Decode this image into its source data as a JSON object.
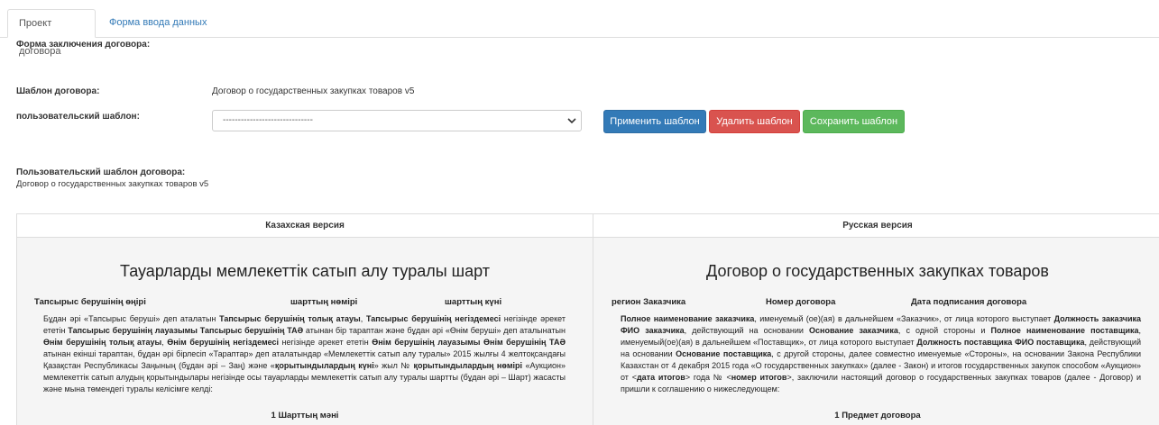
{
  "tabs": [
    {
      "label": "Проект договора",
      "active": true
    },
    {
      "label": "Форма ввода данных",
      "active": false
    }
  ],
  "form": {
    "conclusion_label": "Форма заключения договора:",
    "template_label": "Шаблон договора:",
    "template_value": "Договор о государственных закупках товаров v5",
    "user_template_label": "пользовательский шаблон:",
    "user_template_selected": "------------------------------",
    "buttons": {
      "apply": "Применить шаблон",
      "delete": "Удалить шаблон",
      "save": "Сохранить шаблон"
    },
    "user_template_caption": "Пользовательский шаблон договора:",
    "user_template_name": "Договор о государственных закупках товаров v5"
  },
  "versions": {
    "kz": {
      "header": "Казахская версия",
      "title": "Тауарларды мемлекеттік сатып алу туралы шарт",
      "meta": [
        "Тапсырыс берушінің өңірі",
        "шарттың нөмірі",
        "шарттың күні"
      ],
      "section": "1 Шарттың мәні"
    },
    "ru": {
      "header": "Русская версия",
      "title": "Договор о государственных закупках товаров",
      "meta": [
        "регион Заказчика",
        "Номер договора",
        "Дата подписания договора"
      ],
      "section": "1 Предмет договора"
    }
  },
  "colors": {
    "primary": "#337ab7",
    "danger": "#d9534f",
    "success": "#5cb85c",
    "link": "#337ab7",
    "panel_bg": "#f5f5f5"
  },
  "icons": {
    "select_arrow": "chevron-down-icon"
  }
}
